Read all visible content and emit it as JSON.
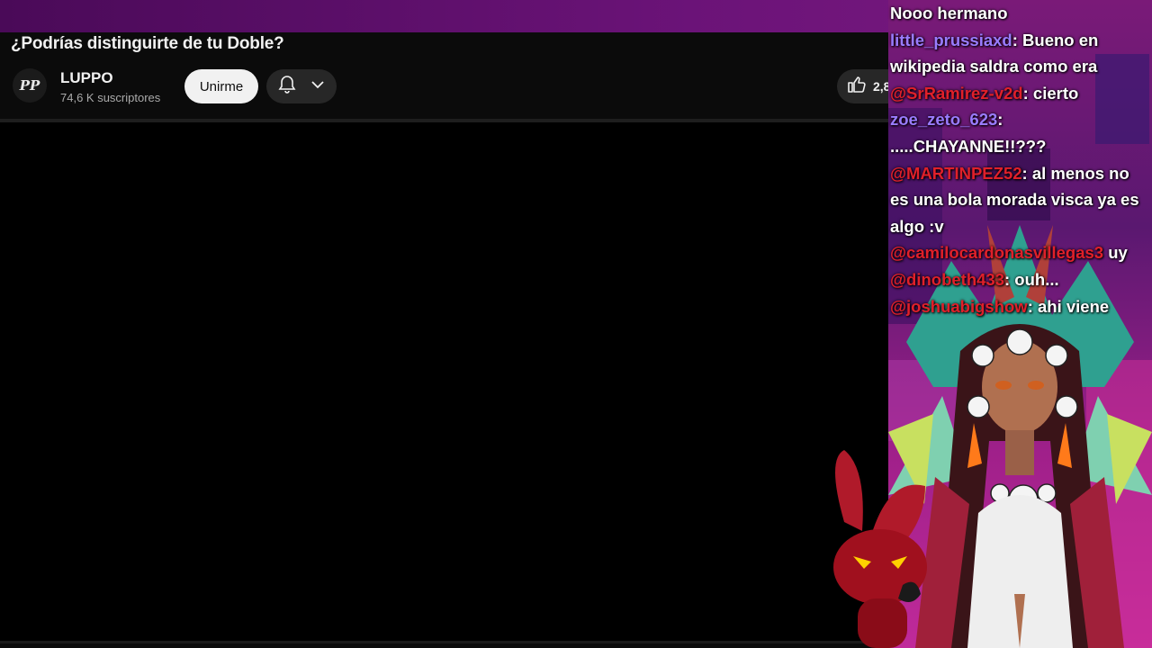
{
  "video": {
    "title": "¿Podrías distinguirte de tu Doble?"
  },
  "channel": {
    "avatar_text": "PP",
    "name": "LUPPO",
    "subscribers": "74,6 K suscriptores",
    "join_label": "Unirme",
    "like_count": "2,8"
  },
  "chat": {
    "messages": [
      {
        "user": "",
        "text": "Nooo hermano"
      },
      {
        "user": "little_prussiaxd",
        "sep": ":",
        "text": " Bueno en wikipedia saldra como era"
      },
      {
        "user": "@SrRamirez-v2d",
        "sep": ":",
        "text": " cierto"
      },
      {
        "user": "zoe_zeto_623",
        "sep": ":",
        "text": " .....CHAYANNE!!???"
      },
      {
        "user": "@MARTINPEZ52",
        "sep": ":",
        "text": " al menos no es una bola morada visca ya es algo :v"
      },
      {
        "user": "@camilocardonasvillegas3",
        "sep": "",
        "text": " uy"
      },
      {
        "user": "@dinobeth433",
        "sep": ":",
        "text": " ouh..."
      },
      {
        "user": "@joshuabigshow",
        "sep": ":",
        "text": " ahi viene"
      }
    ]
  },
  "colors": {
    "topbar": "#5a0f68",
    "join_button_bg": "#f1f1f1",
    "chat_user_purple": "#9a7cff",
    "chat_user_red": "#e0202a"
  }
}
